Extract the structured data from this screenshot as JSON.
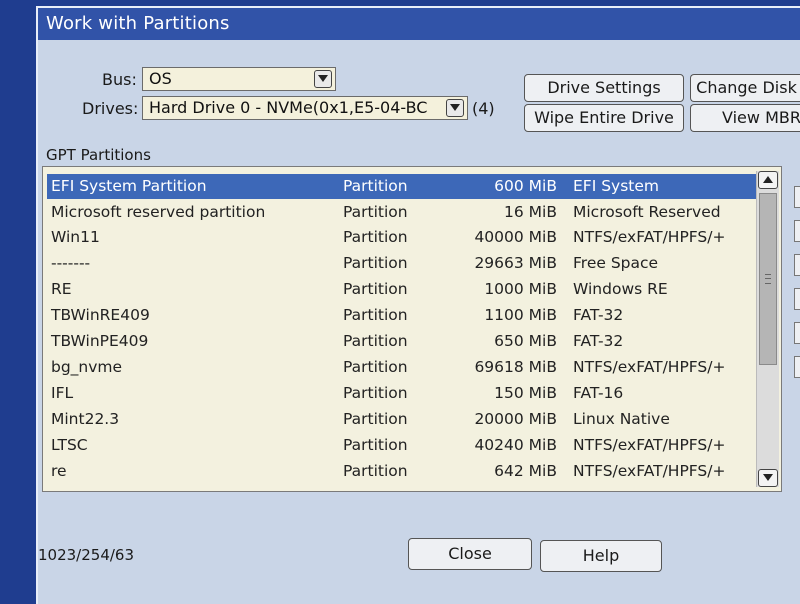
{
  "window": {
    "title": "Work with Partitions"
  },
  "bus": {
    "label": "Bus:",
    "value": "OS"
  },
  "drives": {
    "label": "Drives:",
    "value": "Hard Drive 0 - NVMe(0x1,E5-04-BC",
    "count": "(4)"
  },
  "buttons": {
    "drive_settings": "Drive Settings",
    "change_disk": "Change Disk",
    "wipe_entire_drive": "Wipe Entire Drive",
    "view_mbr": "View MBR",
    "close": "Close",
    "help": "Help"
  },
  "partitions": {
    "label": "GPT Partitions",
    "rows": [
      {
        "name": "EFI System Partition",
        "type": "Partition",
        "size": "600 MiB",
        "fs": "EFI System"
      },
      {
        "name": "Microsoft reserved partition",
        "type": "Partition",
        "size": "16 MiB",
        "fs": "Microsoft Reserved"
      },
      {
        "name": "Win11",
        "type": "Partition",
        "size": "40000 MiB",
        "fs": "NTFS/exFAT/HPFS/+"
      },
      {
        "name": "-------",
        "type": "Partition",
        "size": "29663 MiB",
        "fs": "Free Space"
      },
      {
        "name": "RE",
        "type": "Partition",
        "size": "1000 MiB",
        "fs": "Windows RE"
      },
      {
        "name": "TBWinRE409",
        "type": "Partition",
        "size": "1100 MiB",
        "fs": "FAT-32"
      },
      {
        "name": "TBWinPE409",
        "type": "Partition",
        "size": "650 MiB",
        "fs": "FAT-32"
      },
      {
        "name": "bg_nvme",
        "type": "Partition",
        "size": "69618 MiB",
        "fs": "NTFS/exFAT/HPFS/+"
      },
      {
        "name": "IFL",
        "type": "Partition",
        "size": "150 MiB",
        "fs": "FAT-16"
      },
      {
        "name": "Mint22.3",
        "type": "Partition",
        "size": "20000 MiB",
        "fs": "Linux Native"
      },
      {
        "name": "LTSC",
        "type": "Partition",
        "size": "40240 MiB",
        "fs": "NTFS/exFAT/HPFS/+"
      },
      {
        "name": "re",
        "type": "Partition",
        "size": "642 MiB",
        "fs": "NTFS/exFAT/HPFS/+"
      }
    ]
  },
  "status": {
    "geometry": "1023/254/63"
  },
  "colors": {
    "selection": "#3d68b8",
    "titlebar": "#3153a8",
    "list_bg": "#f3f1df"
  }
}
